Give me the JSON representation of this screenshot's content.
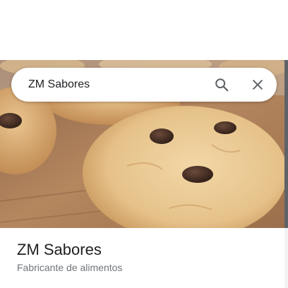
{
  "search": {
    "value": "ZM Sabores",
    "search_icon": "search-icon",
    "close_icon": "close-icon"
  },
  "hero": {
    "alt": "Cookies photo"
  },
  "place": {
    "name": "ZM Sabores",
    "category": "Fabricante de alimentos"
  },
  "colors": {
    "text_primary": "#202124",
    "text_secondary": "#70757a",
    "icon": "#5f6368"
  }
}
